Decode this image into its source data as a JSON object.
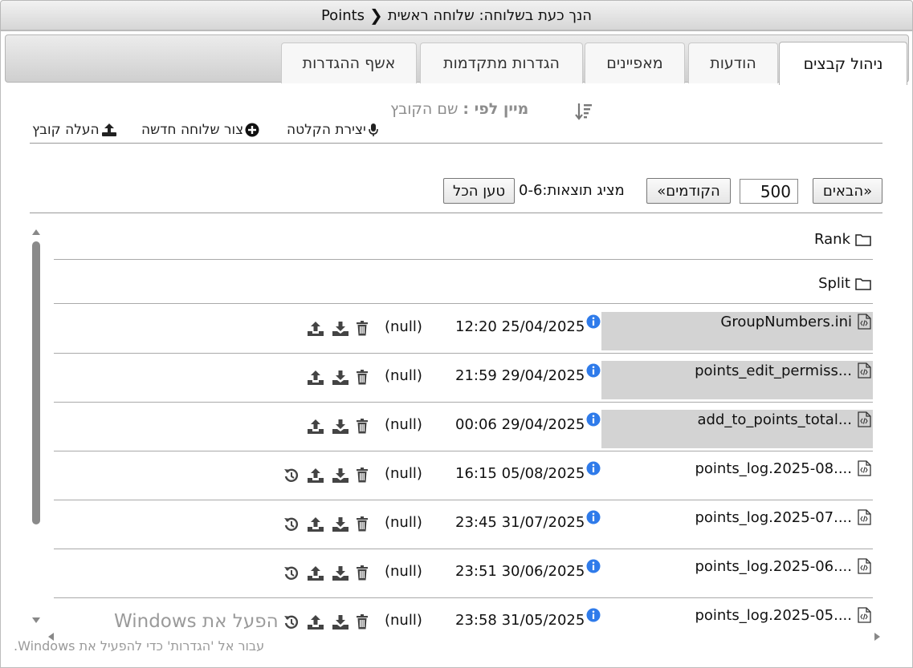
{
  "header": {
    "title_prefix": "הנך כעת בשלוחה: שלוחה ראשית",
    "title_current": "Points"
  },
  "tabs": [
    {
      "label": "ניהול קבצים",
      "active": true
    },
    {
      "label": "הודעות"
    },
    {
      "label": "מאפיינים"
    },
    {
      "label": "הגדרות מתקדמות"
    },
    {
      "label": "אשף ההגדרות"
    }
  ],
  "toolbar": {
    "sort_label": "מיין לפי :",
    "sort_value": "שם הקובץ",
    "record_label": "יצירת הקלטה",
    "new_ext_label": "צור שלוחה חדשה",
    "upload_label": "העלה קובץ"
  },
  "pagination": {
    "next_label": "«הבאים",
    "page_size": "500",
    "prev_label": "הקודמים»",
    "shown_text": "מציג תוצאות:0-6",
    "load_all_label": "טען הכל"
  },
  "folders": [
    {
      "name": "Rank"
    },
    {
      "name": "Split"
    }
  ],
  "files": [
    {
      "name": "GroupNumbers.ini",
      "date": "12:20 25/04/2025",
      "size": "(null)",
      "highlight": true,
      "restore": false
    },
    {
      "name": "points_edit_permiss...",
      "date": "21:59 29/04/2025",
      "size": "(null)",
      "highlight": true,
      "restore": false
    },
    {
      "name": "add_to_points_total...",
      "date": "00:06 29/04/2025",
      "size": "(null)",
      "highlight": true,
      "restore": false
    },
    {
      "name": "points_log.2025-08....",
      "date": "16:15 05/08/2025",
      "size": "(null)",
      "highlight": false,
      "restore": true
    },
    {
      "name": "points_log.2025-07....",
      "date": "23:45 31/07/2025",
      "size": "(null)",
      "highlight": false,
      "restore": true
    },
    {
      "name": "points_log.2025-06....",
      "date": "23:51 30/06/2025",
      "size": "(null)",
      "highlight": false,
      "restore": true
    },
    {
      "name": "points_log.2025-05....",
      "date": "23:58 31/05/2025",
      "size": "(null)",
      "highlight": false,
      "restore": true
    }
  ],
  "watermark": {
    "line1": "הפעל את Windows",
    "line2": "עבור אל 'הגדרות' כדי להפעיל את Windows."
  },
  "colors": {
    "info_blue": "#2f7bea",
    "icon_dark": "#444444",
    "highlight_gray": "#d3d3d3"
  }
}
